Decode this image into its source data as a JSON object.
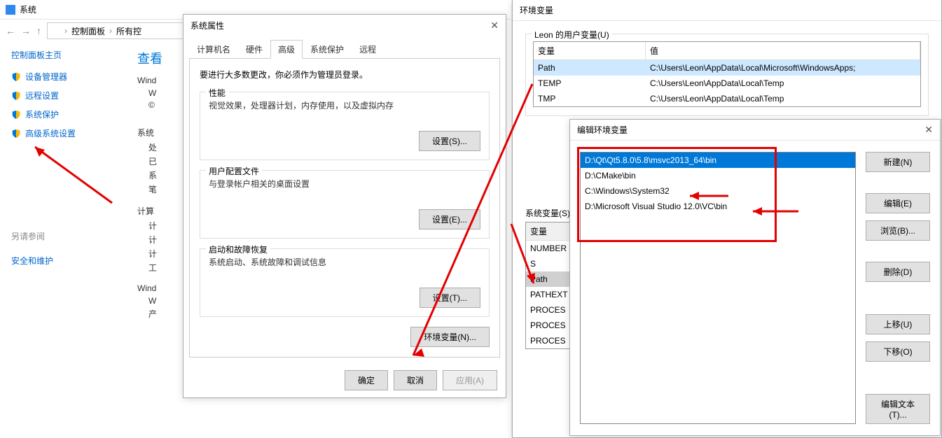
{
  "system_window": {
    "title": "系统",
    "breadcrumb": {
      "item1": "控制面板",
      "item2": "所有控"
    },
    "sidebar": {
      "header": "控制面板主页",
      "items": [
        "设备管理器",
        "远程设置",
        "系统保护",
        "高级系统设置"
      ]
    },
    "main": {
      "heading": "查看",
      "row1": "Wind",
      "indent": [
        "W",
        "©"
      ],
      "row2": "系统",
      "indent2": [
        "处",
        "已",
        "系",
        "笔"
      ],
      "row3": "计算",
      "indent3": [
        "计",
        "计",
        "计",
        "工"
      ],
      "row4": "Wind",
      "indent4": [
        "W",
        "产"
      ],
      "see_also_hdr": "另请参阅",
      "see_also": "安全和维护"
    }
  },
  "sysprop": {
    "title": "系统属性",
    "tabs": [
      "计算机名",
      "硬件",
      "高级",
      "系统保护",
      "远程"
    ],
    "instruct": "要进行大多数更改，你必须作为管理员登录。",
    "perf": {
      "label": "性能",
      "text": "视觉效果，处理器计划，内存使用，以及虚拟内存",
      "btn": "设置(S)..."
    },
    "profile": {
      "label": "用户配置文件",
      "text": "与登录帐户相关的桌面设置",
      "btn": "设置(E)..."
    },
    "startup": {
      "label": "启动和故障恢复",
      "text": "系统启动、系统故障和调试信息",
      "btn": "设置(T)..."
    },
    "envbtn": "环境变量(N)...",
    "ok": "确定",
    "cancel": "取消",
    "apply": "应用(A)"
  },
  "envvars": {
    "title": "环境变量",
    "user_label": "Leon 的用户变量(U)",
    "th_var": "变量",
    "th_val": "值",
    "user_rows": [
      {
        "var": "Path",
        "val": "C:\\Users\\Leon\\AppData\\Local\\Microsoft\\WindowsApps;"
      },
      {
        "var": "TEMP",
        "val": "C:\\Users\\Leon\\AppData\\Local\\Temp"
      },
      {
        "var": "TMP",
        "val": "C:\\Users\\Leon\\AppData\\Local\\Temp"
      }
    ],
    "sys_label": "系统变量(S)",
    "sys_rows": [
      {
        "var": "变量"
      },
      {
        "var": "NUMBER"
      },
      {
        "var": "S"
      },
      {
        "var": "Path"
      },
      {
        "var": "PATHEXT"
      },
      {
        "var": "PROCES"
      },
      {
        "var": "PROCES"
      },
      {
        "var": "PROCES"
      }
    ]
  },
  "editenv": {
    "title": "编辑环境变量",
    "items": [
      "D:\\Qt\\Qt5.8.0\\5.8\\msvc2013_64\\bin",
      "D:\\CMake\\bin",
      "C:\\Windows\\System32",
      "D:\\Microsoft Visual Studio 12.0\\VC\\bin"
    ],
    "btns": {
      "new": "新建(N)",
      "edit": "编辑(E)",
      "browse": "浏览(B)...",
      "delete": "删除(D)",
      "up": "上移(U)",
      "down": "下移(O)",
      "edit_text": "编辑文本(T)..."
    }
  }
}
